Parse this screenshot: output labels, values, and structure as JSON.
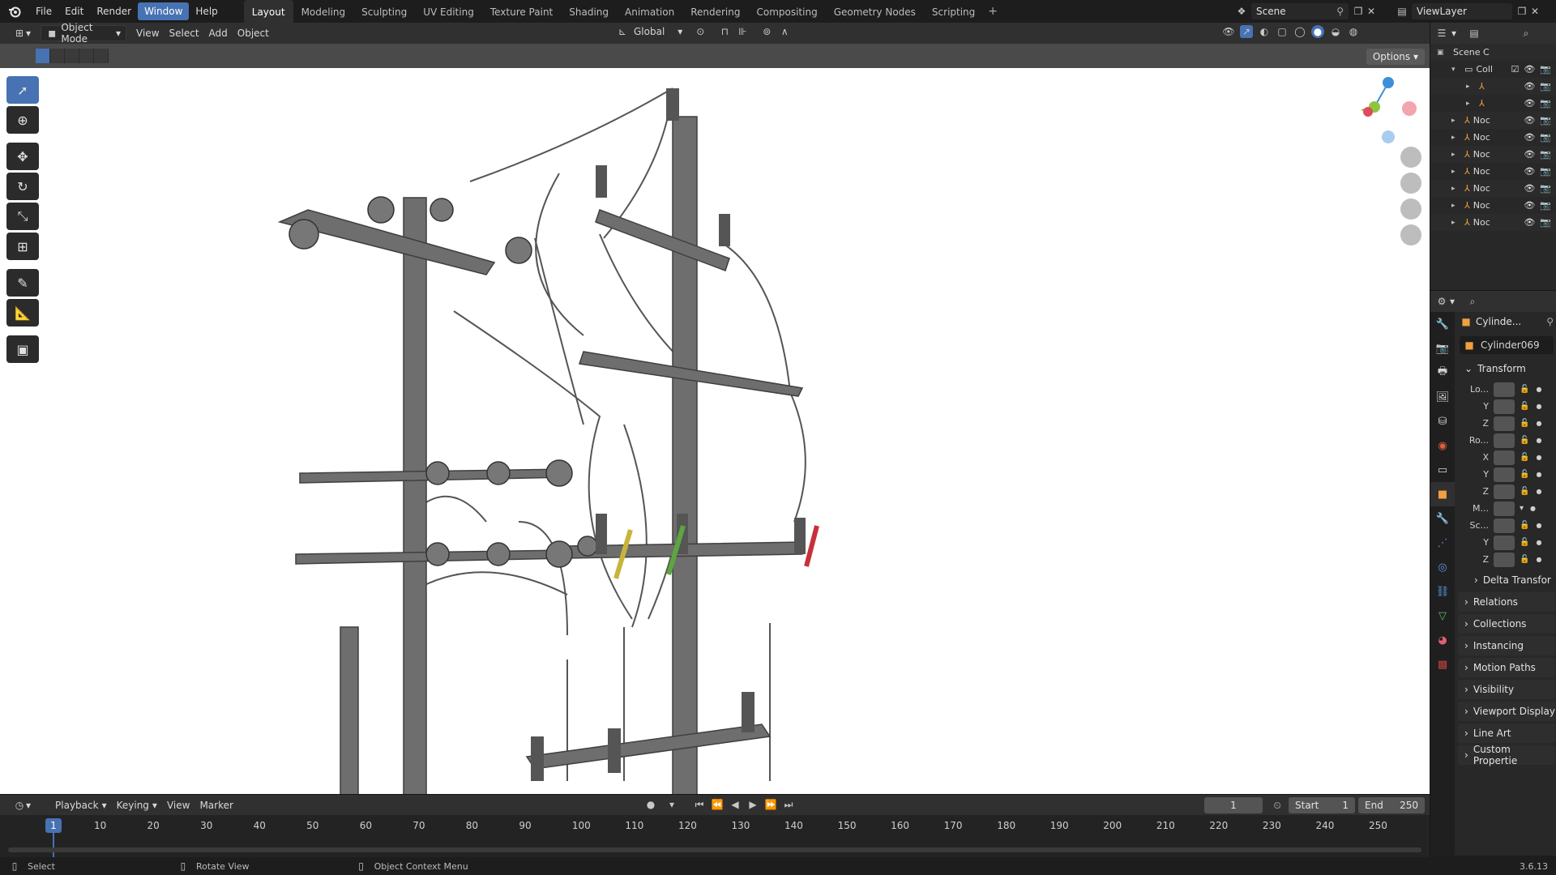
{
  "menu": [
    "File",
    "Edit",
    "Render",
    "Window",
    "Help"
  ],
  "active_menu": "Window",
  "workspaces": [
    "Layout",
    "Modeling",
    "Sculpting",
    "UV Editing",
    "Texture Paint",
    "Shading",
    "Animation",
    "Rendering",
    "Compositing",
    "Geometry Nodes",
    "Scripting"
  ],
  "active_workspace": "Layout",
  "scene_name": "Scene",
  "view_layer": "ViewLayer",
  "viewport_header": {
    "mode": "Object Mode",
    "menus": [
      "View",
      "Select",
      "Add",
      "Object"
    ],
    "orientation": "Global"
  },
  "options_label": "Options",
  "outliner": {
    "rows": [
      {
        "label": "Scene C",
        "depth": 0
      },
      {
        "label": "Coll",
        "depth": 1
      },
      {
        "label": "",
        "depth": 2
      },
      {
        "label": "",
        "depth": 2
      },
      {
        "label": "Noc",
        "depth": 1
      },
      {
        "label": "Noc",
        "depth": 1
      },
      {
        "label": "Noc",
        "depth": 1
      },
      {
        "label": "Noc",
        "depth": 1
      },
      {
        "label": "Noc",
        "depth": 1
      },
      {
        "label": "Noc",
        "depth": 1
      },
      {
        "label": "Noc",
        "depth": 1
      }
    ]
  },
  "properties": {
    "object_short": "Cylinde...",
    "object_name": "Cylinder069",
    "transform_label": "Transform",
    "rows": [
      {
        "label": "Lo..."
      },
      {
        "label": "Y"
      },
      {
        "label": "Z"
      },
      {
        "label": "Ro..."
      },
      {
        "label": "X"
      },
      {
        "label": "Y"
      },
      {
        "label": "Z"
      },
      {
        "label": "M..."
      },
      {
        "label": "Sc..."
      },
      {
        "label": "Y"
      },
      {
        "label": "Z"
      }
    ],
    "delta": "Delta Transfor",
    "panels": [
      "Relations",
      "Collections",
      "Instancing",
      "Motion Paths",
      "Visibility",
      "Viewport Display",
      "Line Art",
      "Custom Propertie"
    ]
  },
  "timeline": {
    "menus": [
      "Playback",
      "Keying",
      "View",
      "Marker"
    ],
    "current_frame": "1",
    "start_label": "Start",
    "start": "1",
    "end_label": "End",
    "end": "250",
    "ticks": [
      "1",
      "10",
      "20",
      "30",
      "40",
      "50",
      "60",
      "70",
      "80",
      "90",
      "100",
      "110",
      "120",
      "130",
      "140",
      "150",
      "160",
      "170",
      "180",
      "190",
      "200",
      "210",
      "220",
      "230",
      "240",
      "250"
    ]
  },
  "status": {
    "select": "Select",
    "rotate": "Rotate View",
    "context": "Object Context Menu",
    "version": "3.6.13"
  },
  "colors": {
    "accent": "#4772b3",
    "axis_x": "#e04a5d",
    "axis_y": "#8cc63f",
    "axis_z": "#3d8fd9"
  }
}
